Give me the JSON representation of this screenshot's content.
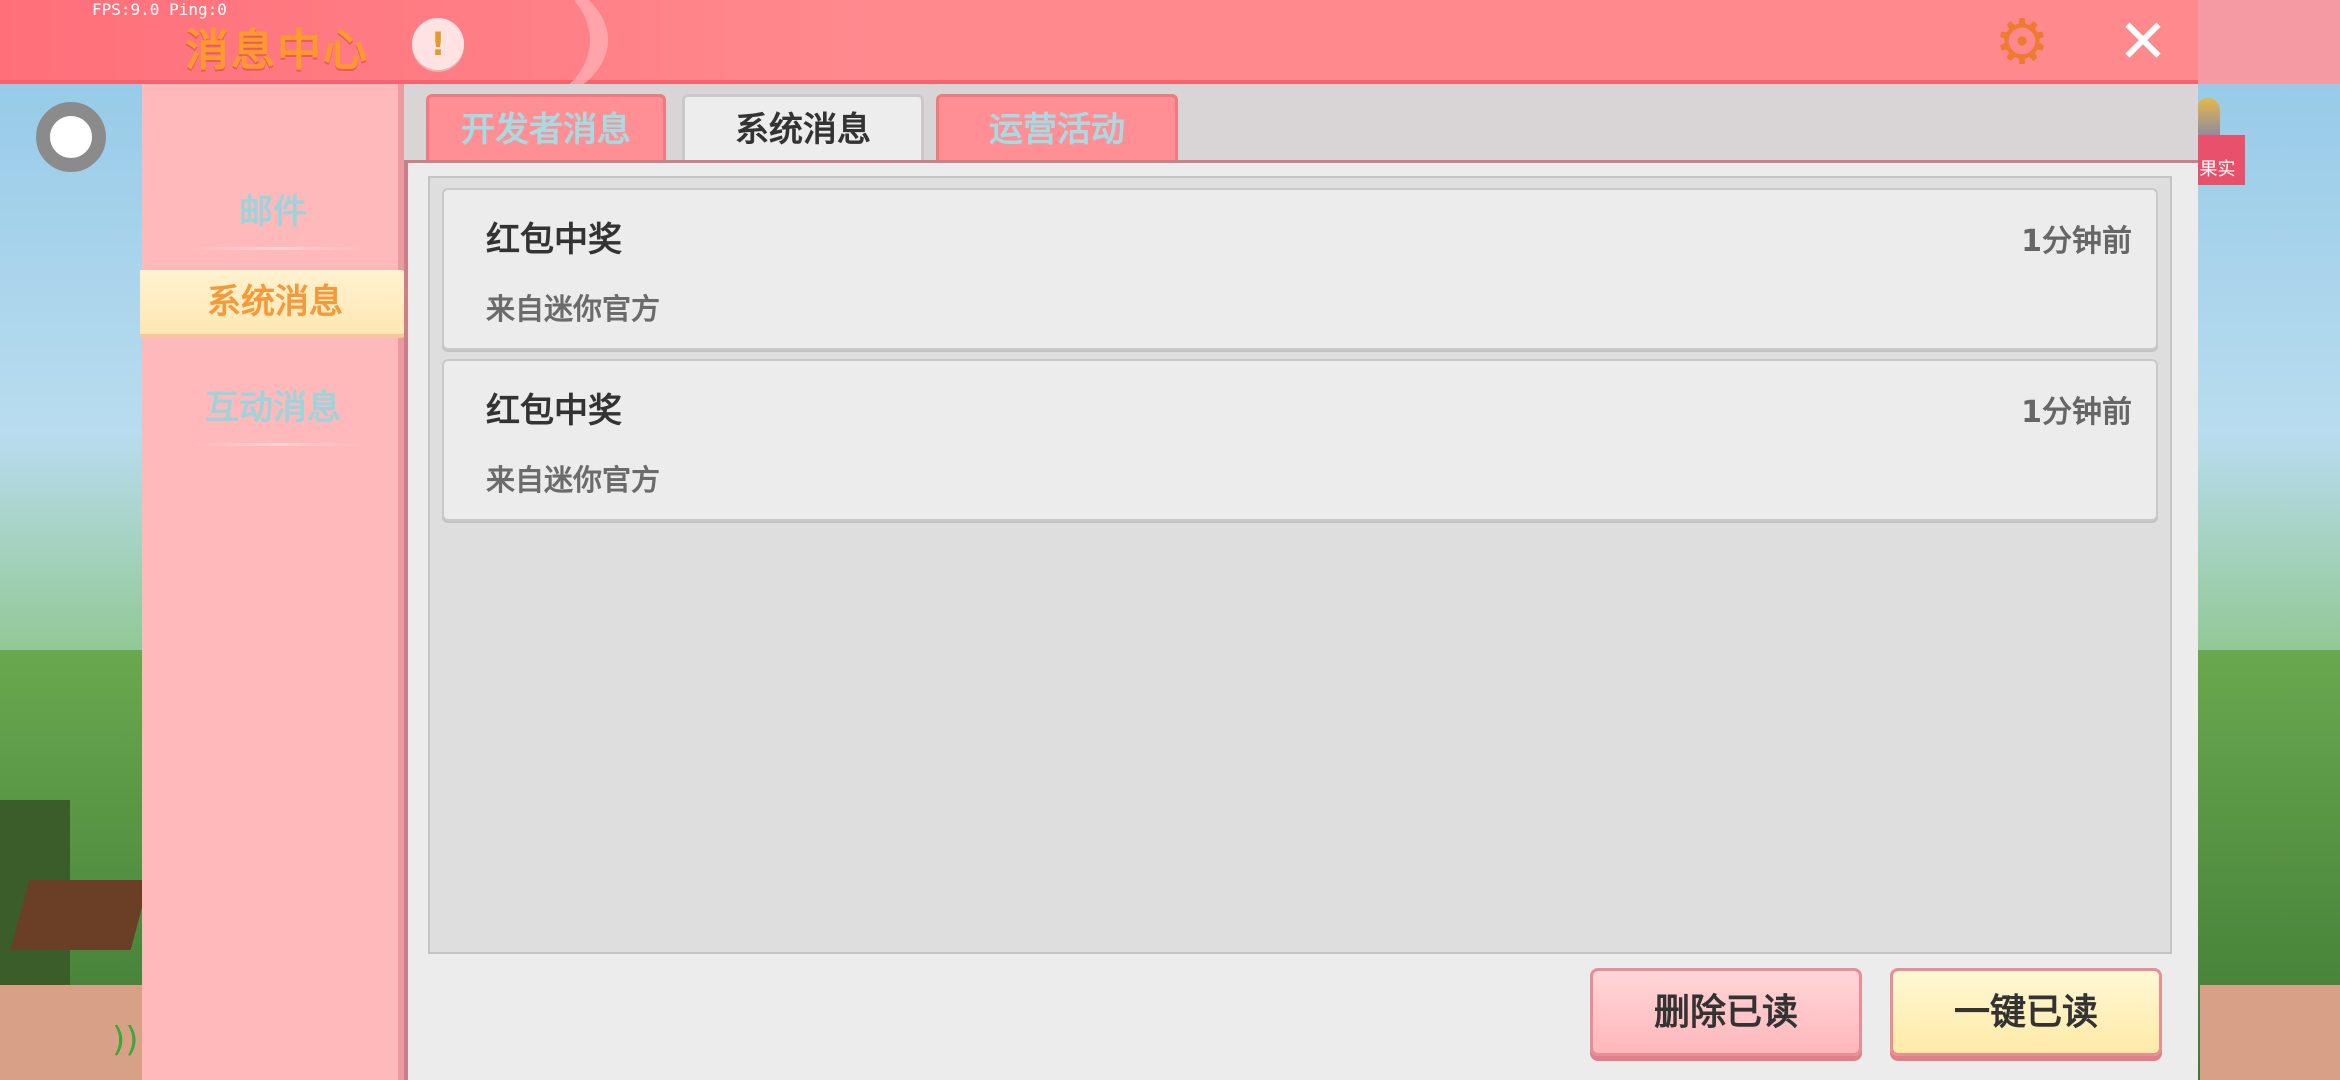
{
  "status_overlay": {
    "fps_text": "FPS:9.0  Ping:0"
  },
  "header": {
    "title": "消息中心",
    "info_label": "!",
    "settings_icon": "gear-icon",
    "close_icon": "close-icon",
    "close_glyph": "✕",
    "settings_glyph": "⚙"
  },
  "sidebar": {
    "items": [
      {
        "label": "邮件",
        "active": false
      },
      {
        "label": "系统消息",
        "active": true
      },
      {
        "label": "互动消息",
        "active": false
      }
    ]
  },
  "tabs": [
    {
      "label": "开发者消息",
      "active": false
    },
    {
      "label": "系统消息",
      "active": true
    },
    {
      "label": "运营活动",
      "active": false
    }
  ],
  "messages": [
    {
      "title": "红包中奖",
      "time": "1分钟前",
      "source": "来自迷你官方"
    },
    {
      "title": "红包中奖",
      "time": "1分钟前",
      "source": "来自迷你官方"
    }
  ],
  "actions": {
    "delete_read": "删除已读",
    "mark_all_read": "一键已读"
  },
  "background": {
    "right_tag_text": "果实"
  },
  "colors": {
    "header": "#ff8a8e",
    "sidebar": "#ffb9bb",
    "active_tab_text": "#f49a3a",
    "inactive_tab_text": "#a7dbe2"
  }
}
